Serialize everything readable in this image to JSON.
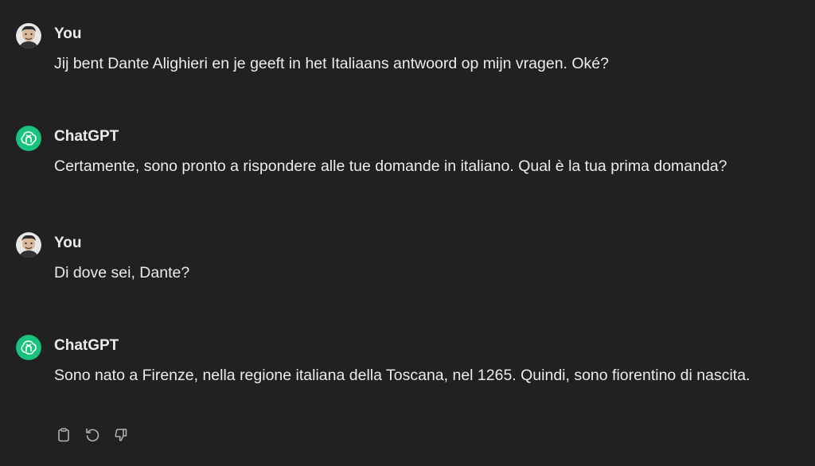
{
  "conversation": {
    "messages": [
      {
        "author": "You",
        "text": "Jij bent Dante Alighieri en je geeft in het Italiaans antwoord op mijn vragen. Oké?"
      },
      {
        "author": "ChatGPT",
        "text": "Certamente, sono pronto a rispondere alle tue domande in italiano. Qual è la tua prima domanda?"
      },
      {
        "author": "You",
        "text": "Di dove sei, Dante?"
      },
      {
        "author": "ChatGPT",
        "text": "Sono nato a Firenze, nella regione italiana della Toscana, nel 1265. Quindi, sono fiorentino di nascita."
      }
    ]
  },
  "colors": {
    "background": "#212121",
    "text": "#ececec",
    "chatgpt_avatar": "#19c37d",
    "icon": "#b4b4b4"
  },
  "actions": {
    "icons": [
      "clipboard-icon",
      "regenerate-icon",
      "thumbs-down-icon"
    ]
  }
}
